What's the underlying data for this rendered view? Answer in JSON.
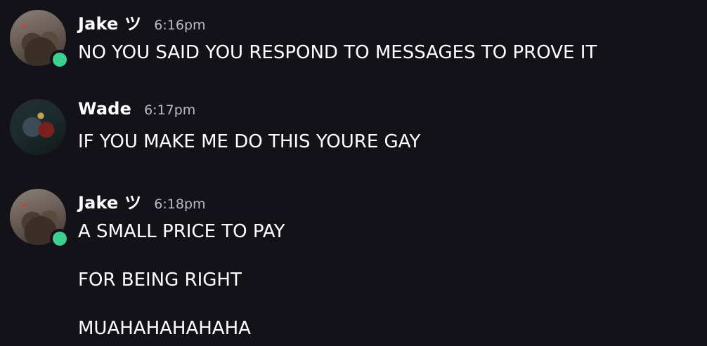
{
  "messages": [
    {
      "author": "Jake ツ",
      "time": "6:16pm",
      "avatar": "jake-avatar",
      "online": true,
      "lines": [
        "NO YOU SAID YOU RESPOND TO MESSAGES TO PROVE IT"
      ]
    },
    {
      "author": "Wade",
      "time": "6:17pm",
      "avatar": "wade-avatar",
      "online": false,
      "lines": [
        "IF YOU MAKE ME DO THIS YOURE GAY"
      ]
    },
    {
      "author": "Jake ツ",
      "time": "6:18pm",
      "avatar": "jake-avatar",
      "online": true,
      "lines": [
        "A SMALL PRICE TO PAY",
        "FOR BEING RIGHT",
        "MUAHAHAHAHAHA"
      ]
    }
  ],
  "colors": {
    "background": "#141219",
    "online": "#3ccf91",
    "text": "#ffffff",
    "timestamp": "#bdbac3"
  }
}
